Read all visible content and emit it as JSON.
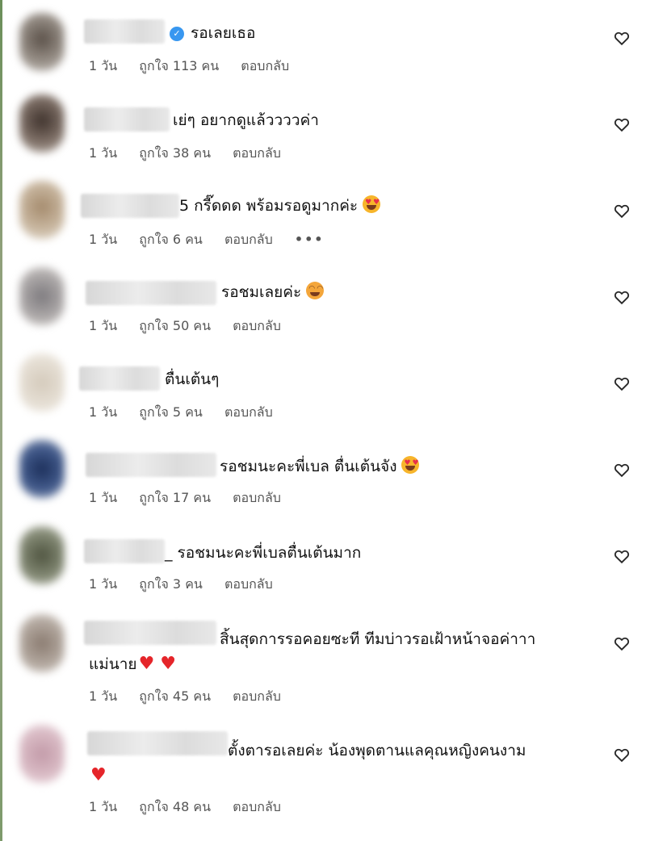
{
  "comments": [
    {
      "text": "รอเลยเธอ",
      "verified": true,
      "emoji": "",
      "time": "1 วัน",
      "likes": "ถูกใจ 113 คน",
      "reply": "ตอบกลับ",
      "more": ""
    },
    {
      "text": "เย่ๆ อยากดูแล้ววววค่า",
      "verified": false,
      "emoji": "",
      "time": "1 วัน",
      "likes": "ถูกใจ 38 คน",
      "reply": "ตอบกลับ",
      "more": ""
    },
    {
      "text": "5 กรี๊ดดด พร้อมรอดูมากค่ะ",
      "verified": false,
      "emoji": "heart-eyes-emoji",
      "time": "1 วัน",
      "likes": "ถูกใจ 6 คน",
      "reply": "ตอบกลับ",
      "more": "•••"
    },
    {
      "text": "รอชมเลยค่ะ",
      "verified": false,
      "emoji": "smiling-face-emoji",
      "time": "1 วัน",
      "likes": "ถูกใจ 50 คน",
      "reply": "ตอบกลับ",
      "more": ""
    },
    {
      "text": "ตื่นเต้นๆ",
      "verified": false,
      "emoji": "",
      "time": "1 วัน",
      "likes": "ถูกใจ 5 คน",
      "reply": "ตอบกลับ",
      "more": ""
    },
    {
      "text": "รอชมนะคะพี่เบล ตื่นเต้นจัง",
      "verified": false,
      "emoji": "heart-eyes-emoji",
      "time": "1 วัน",
      "likes": "ถูกใจ 17 คน",
      "reply": "ตอบกลับ",
      "more": ""
    },
    {
      "text": "_ รอชมนะคะพี่เบลตื่นเต้นมาก",
      "verified": false,
      "emoji": "",
      "time": "1 วัน",
      "likes": "ถูกใจ 3 คน",
      "reply": "ตอบกลับ",
      "more": ""
    },
    {
      "text": "สิ้นสุดการรอคอยซะที ทีมบ่าวรอเฝ้าหน้าจอค่าาา",
      "text2": "แม่นาย",
      "hearts2": "♥ ♥",
      "verified": false,
      "emoji": "",
      "time": "1 วัน",
      "likes": "ถูกใจ 45 คน",
      "reply": "ตอบกลับ",
      "more": ""
    },
    {
      "text": "ตั้งตารอเลยค่ะ น้องพุดตานแลคุณหญิงคนงาม",
      "text2": "",
      "hearts2": "♥",
      "verified": false,
      "emoji": "",
      "time": "1 วัน",
      "likes": "ถูกใจ 48 คน",
      "reply": "ตอบกลับ",
      "more": ""
    }
  ],
  "colors": {
    "verified": "#3897f0",
    "heart": "#e5252a",
    "meta_text": "#555555"
  },
  "icons": {
    "like": "heart-outline-icon",
    "verified": "verified-badge-icon",
    "more": "more-options-icon"
  }
}
